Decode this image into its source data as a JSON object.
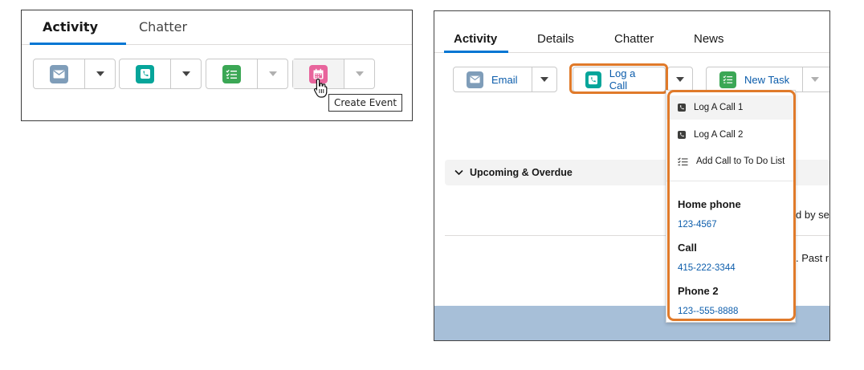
{
  "colors": {
    "email_tile": "#7f9db9",
    "call_tile": "#06a59a",
    "task_tile": "#3ba755",
    "event_tile": "#e8649c",
    "link": "#0b5cab",
    "tab_underline": "#0176d3",
    "highlight": "#e07a2a",
    "footer_band": "#a7bfd8"
  },
  "left_panel": {
    "tabs": [
      {
        "label": "Activity",
        "active": true
      },
      {
        "label": "Chatter",
        "active": false
      }
    ],
    "action_groups": [
      {
        "icon": "email-icon",
        "dropdown": "chevron-down-icon"
      },
      {
        "icon": "phone-icon",
        "dropdown": "chevron-down-icon"
      },
      {
        "icon": "task-icon",
        "dropdown": "chevron-down-icon"
      },
      {
        "icon": "calendar-icon",
        "dropdown": "chevron-down-icon"
      }
    ],
    "tooltip": "Create Event"
  },
  "right_panel": {
    "tabs": [
      {
        "label": "Activity",
        "active": true
      },
      {
        "label": "Details",
        "active": false
      },
      {
        "label": "Chatter",
        "active": false
      },
      {
        "label": "News",
        "active": false
      }
    ],
    "buttons": {
      "email": "Email",
      "log_call": "Log a Call",
      "new_task": "New Task"
    },
    "section_title": "Upcoming & Overdue",
    "behind_text_1": "d by se",
    "behind_text_2": ". Past r",
    "menu": {
      "items": [
        {
          "label": "Log A Call 1",
          "icon": "phone-icon"
        },
        {
          "label": "Log A Call 2",
          "icon": "phone-icon"
        },
        {
          "label": "Add Call to To Do List",
          "icon": "checklist-icon"
        }
      ],
      "phones": [
        {
          "label": "Home phone",
          "number": "123-4567"
        },
        {
          "label": "Call",
          "number": "415-222-3344"
        },
        {
          "label": "Phone 2",
          "number": "123--555-8888"
        }
      ]
    }
  }
}
